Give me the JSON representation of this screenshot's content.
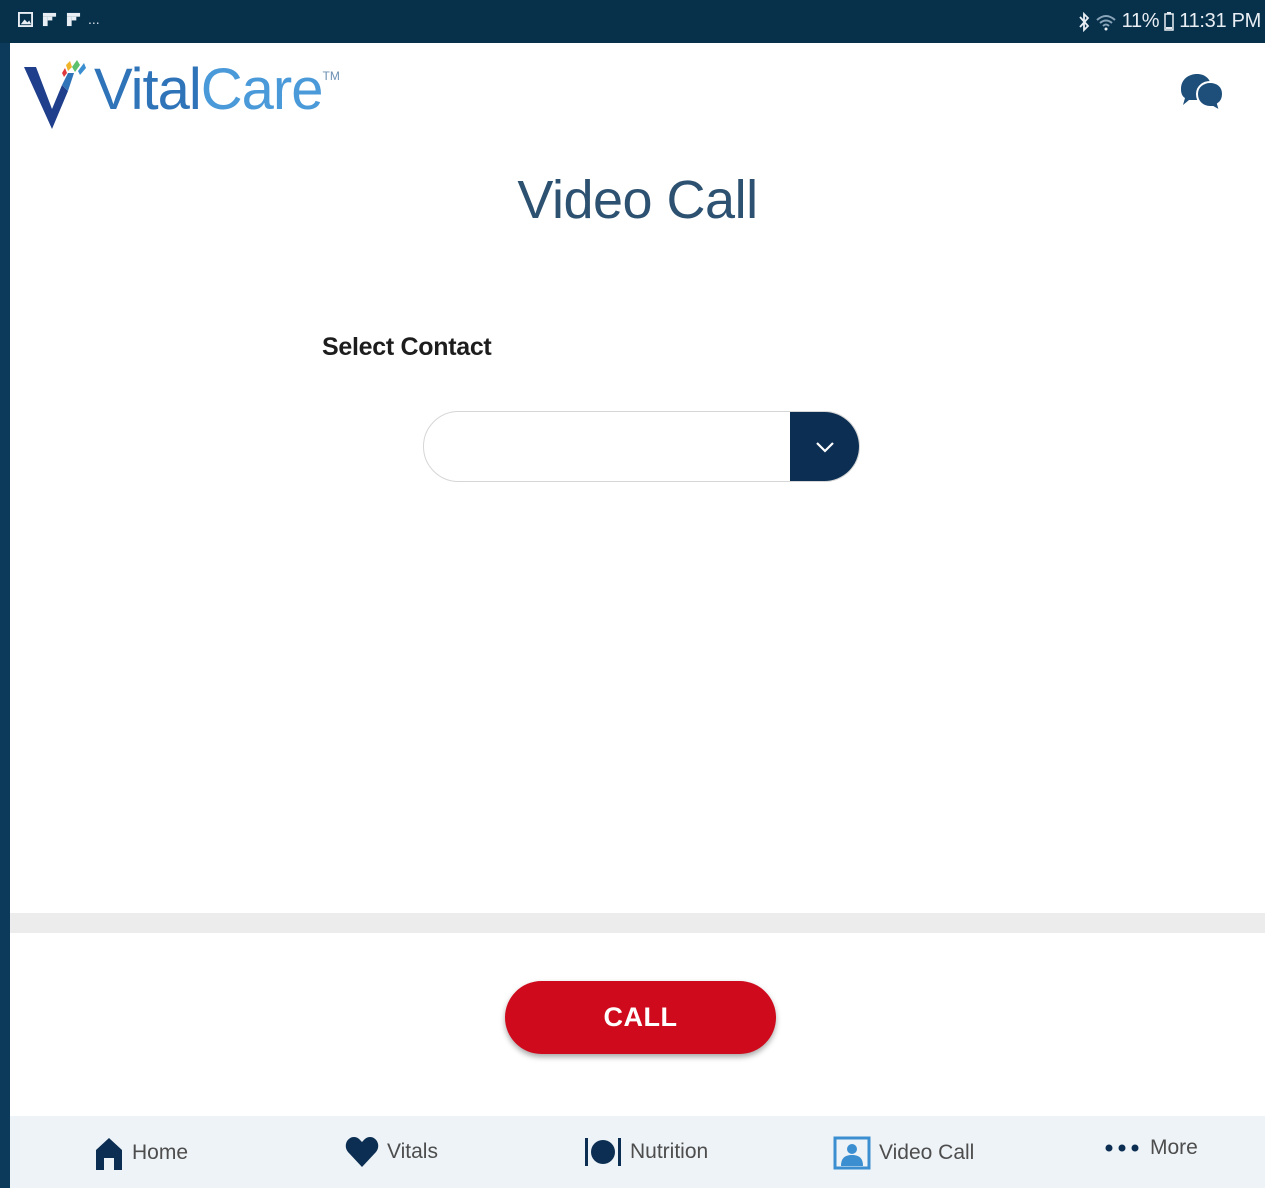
{
  "status_bar": {
    "left_icons": [
      "gallery-icon",
      "flipboard-icon",
      "flipboard-icon"
    ],
    "overflow": "...",
    "battery_text": "11%",
    "time": "11:31 PM",
    "right_icons": [
      "bluetooth-icon",
      "wifi-icon",
      "battery-icon"
    ]
  },
  "header": {
    "logo_text_vital": "Vital",
    "logo_text_care": "Care",
    "logo_tm": "TM",
    "chat_icon": "chat-bubbles-icon"
  },
  "page": {
    "title": "Video Call",
    "select_label": "Select Contact",
    "dropdown_value": "",
    "call_button": "CALL"
  },
  "nav": {
    "items": [
      {
        "label": "Home",
        "icon": "home-icon"
      },
      {
        "label": "Vitals",
        "icon": "heart-icon"
      },
      {
        "label": "Nutrition",
        "icon": "plate-utensils-icon"
      },
      {
        "label": "Video Call",
        "icon": "video-call-icon"
      },
      {
        "label": "More",
        "icon": "more-dots-icon"
      }
    ]
  },
  "colors": {
    "brand_dark": "#0b2e52",
    "accent_red": "#cf0a1c",
    "logo_blue": "#2f73b8",
    "video_call_blue": "#3b8fd1"
  }
}
